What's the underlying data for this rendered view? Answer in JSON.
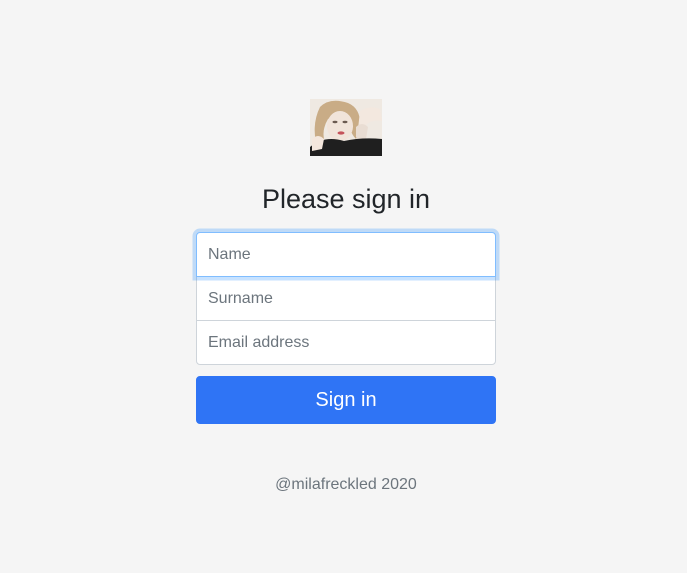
{
  "page": {
    "heading": "Please sign in"
  },
  "avatar": {
    "icon": "user-portrait-image"
  },
  "form": {
    "name_placeholder": "Name",
    "name_value": "",
    "surname_placeholder": "Surname",
    "surname_value": "",
    "email_placeholder": "Email address",
    "email_value": "",
    "submit_label": "Sign in"
  },
  "footer": {
    "text": "@milafreckled 2020"
  },
  "colors": {
    "background": "#f5f5f5",
    "primary": "#2f74f5",
    "focus_border": "#80bdff",
    "muted_text": "#6c757d"
  }
}
